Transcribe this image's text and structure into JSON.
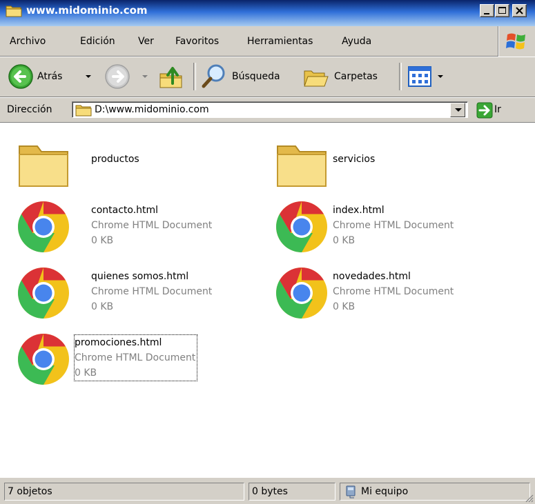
{
  "window": {
    "title": "www.midominio.com"
  },
  "menu": {
    "items": [
      "Archivo",
      "Edición",
      "Ver",
      "Favoritos",
      "Herramientas",
      "Ayuda"
    ]
  },
  "toolbar": {
    "back_label": "Atrás",
    "search_label": "Búsqueda",
    "folders_label": "Carpetas",
    "icons": [
      "back-arrow-icon",
      "forward-arrow-icon",
      "up-folder-icon",
      "search-magnifier-icon",
      "folders-icon",
      "views-icon"
    ]
  },
  "address": {
    "label": "Dirección",
    "value": "D:\\www.midominio.com",
    "go_label": "Ir"
  },
  "files": [
    {
      "name": "productos",
      "type": "",
      "size": "",
      "kind": "folder"
    },
    {
      "name": "servicios",
      "type": "",
      "size": "",
      "kind": "folder"
    },
    {
      "name": "contacto.html",
      "type": "Chrome HTML Document",
      "size": "0 KB",
      "kind": "chrome"
    },
    {
      "name": "index.html",
      "type": "Chrome HTML Document",
      "size": "0 KB",
      "kind": "chrome"
    },
    {
      "name": "quienes somos.html",
      "type": "Chrome HTML Document",
      "size": "0 KB",
      "kind": "chrome"
    },
    {
      "name": "novedades.html",
      "type": "Chrome HTML Document",
      "size": "0 KB",
      "kind": "chrome"
    },
    {
      "name": "promociones.html",
      "type": "Chrome HTML Document",
      "size": "0 KB",
      "kind": "chrome",
      "selected": true
    }
  ],
  "status": {
    "objects": "7 objetos",
    "size": "0 bytes",
    "location": "Mi equipo"
  },
  "colors": {
    "titlebar_dark": "#0a246a",
    "titlebar_light": "#a6caf0",
    "chrome_frame": "#d4d0c8",
    "meta_text": "#808080"
  }
}
